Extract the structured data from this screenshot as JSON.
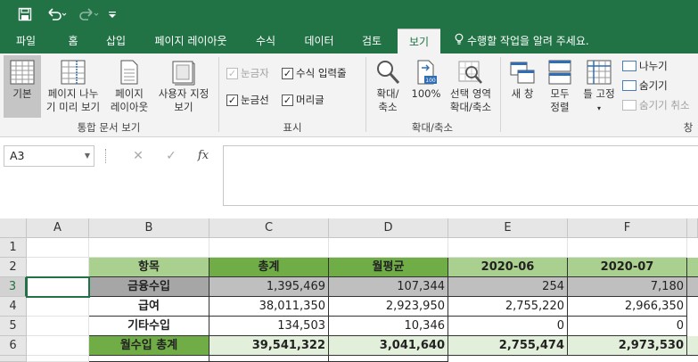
{
  "qat": {
    "save_icon": "save-icon",
    "undo_icon": "undo-icon",
    "redo_icon": "redo-icon",
    "customize_icon": "customize-qat-icon"
  },
  "tabs": [
    {
      "label": "파일"
    },
    {
      "label": "홈"
    },
    {
      "label": "삽입"
    },
    {
      "label": "페이지 레이아웃"
    },
    {
      "label": "수식"
    },
    {
      "label": "데이터"
    },
    {
      "label": "검토"
    },
    {
      "label": "보기"
    }
  ],
  "tell_me": "수행할 작업을 알려 주세요.",
  "ribbon": {
    "views": {
      "normal": "기본",
      "page_break_1": "페이지 나누",
      "page_break_2": "기 미리 보기",
      "page_layout_1": "페이지",
      "page_layout_2": "레이아웃",
      "custom_1": "사용자 지정",
      "custom_2": "보기",
      "group": "통합 문서 보기"
    },
    "show": {
      "ruler": "눈금자",
      "formula_bar": "수식 입력줄",
      "gridlines": "눈금선",
      "headings": "머리글",
      "group": "표시"
    },
    "zoom": {
      "zoom_1": "확대/",
      "zoom_2": "축소",
      "hundred": "100%",
      "selection_1": "선택 영역",
      "selection_2": "확대/축소",
      "group": "확대/축소"
    },
    "window": {
      "new_window": "새 창",
      "arrange_1": "모두",
      "arrange_2": "정렬",
      "freeze": "틀 고정",
      "split": "나누기",
      "hide": "숨기기",
      "unhide": "숨기기 취소",
      "group": "창"
    }
  },
  "formula_bar": {
    "name_box": "A3",
    "cancel": "✕",
    "enter": "✓",
    "fx": "fx",
    "value": ""
  },
  "columns": [
    "A",
    "B",
    "C",
    "D",
    "E",
    "F"
  ],
  "rows": [
    {
      "num": "1",
      "cells": [
        "",
        "",
        "",
        "",
        "",
        ""
      ]
    },
    {
      "num": "2",
      "cells": [
        "",
        "항목",
        "총계",
        "월평균",
        "2020-06",
        "2020-07"
      ]
    },
    {
      "num": "3",
      "cells": [
        "",
        "금융수입",
        "1,395,469",
        "107,344",
        "254",
        "7,180"
      ]
    },
    {
      "num": "4",
      "cells": [
        "",
        "급여",
        "38,011,350",
        "2,923,950",
        "2,755,220",
        "2,966,350"
      ]
    },
    {
      "num": "5",
      "cells": [
        "",
        "기타수입",
        "134,503",
        "10,346",
        "0",
        "0"
      ]
    },
    {
      "num": "6",
      "cells": [
        "",
        "월수입 총계",
        "39,541,322",
        "3,041,640",
        "2,755,474",
        "2,973,530"
      ]
    },
    {
      "num": "7",
      "cells": [
        "",
        "",
        "",
        "",
        "",
        ""
      ]
    }
  ],
  "colors": {
    "excel_green": "#217346",
    "header_green": "#a9d08e",
    "header_dark_green": "#70ad47",
    "light_green": "#e2efda",
    "gray_row": "#bfbfbf"
  }
}
